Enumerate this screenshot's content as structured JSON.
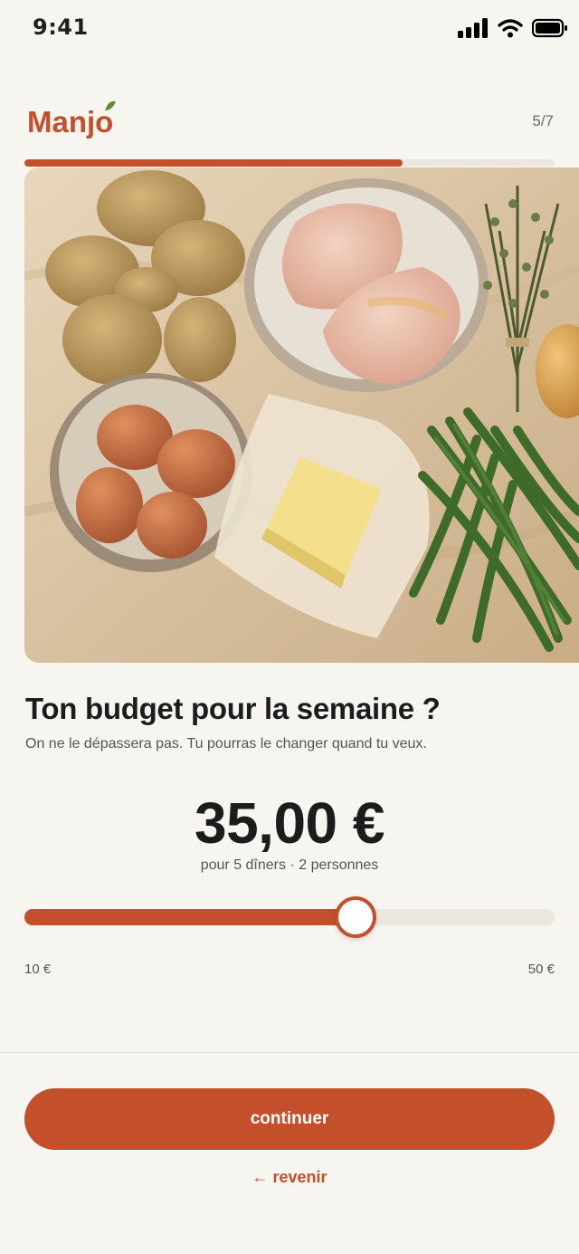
{
  "status_bar": {
    "time": "9:41",
    "icons": [
      "signal-icon",
      "wifi-icon",
      "battery-icon"
    ]
  },
  "header": {
    "logo_text": "Manjo",
    "step": "5/7",
    "progress": 0.714
  },
  "content": {
    "title": "Ton budget pour la semaine ?",
    "subtitle": "On ne le dépassera pas. Tu pourras le changer quand tu veux.",
    "budget_value": "35,00 €",
    "budget_detail": "pour 5 dîners · 2 personnes"
  },
  "slider": {
    "min_label": "10 €",
    "max_label": "50 €",
    "min": 10,
    "max": 50,
    "value": 35
  },
  "actions": {
    "continue_label": "continuer",
    "back_label": "← revenir"
  },
  "colors": {
    "accent": "#c44f2b",
    "background": "#f7f5f0",
    "track": "#ebe7e0"
  }
}
